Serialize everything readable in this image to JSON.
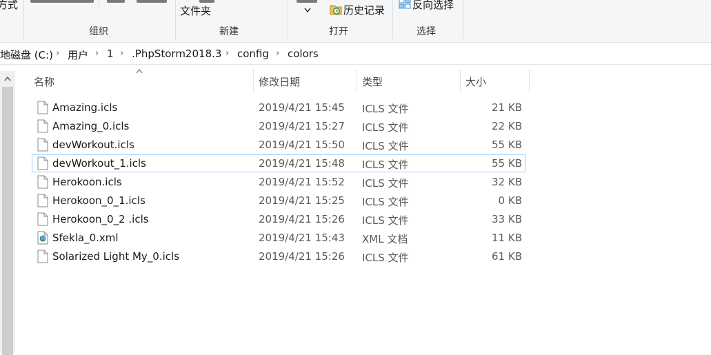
{
  "ribbon": {
    "partial_left": "方式",
    "new_folder_label": "文件夹",
    "history_label": "历史记录",
    "invert_select_label": "反向选择",
    "groups": [
      "组织",
      "新建",
      "打开",
      "选择"
    ]
  },
  "breadcrumb": {
    "items": [
      "地磁盘 (C:)",
      "用户",
      "1",
      ".PhpStorm2018.3",
      "config",
      "colors"
    ]
  },
  "columns": [
    "名称",
    "修改日期",
    "类型",
    "大小"
  ],
  "files": [
    {
      "name": "Amazing.icls",
      "date": "2019/4/21 15:45",
      "type": "ICLS 文件",
      "size": "21 KB",
      "icon": "file-icon"
    },
    {
      "name": "Amazing_0.icls",
      "date": "2019/4/21 15:27",
      "type": "ICLS 文件",
      "size": "22 KB",
      "icon": "file-icon"
    },
    {
      "name": "devWorkout.icls",
      "date": "2019/4/21 15:50",
      "type": "ICLS 文件",
      "size": "55 KB",
      "icon": "file-icon"
    },
    {
      "name": "devWorkout_1.icls",
      "date": "2019/4/21 15:48",
      "type": "ICLS 文件",
      "size": "55 KB",
      "icon": "file-icon",
      "selected": true
    },
    {
      "name": "Herokoon.icls",
      "date": "2019/4/21 15:52",
      "type": "ICLS 文件",
      "size": "32 KB",
      "icon": "file-icon"
    },
    {
      "name": "Herokoon_0_1.icls",
      "date": "2019/4/21 15:25",
      "type": "ICLS 文件",
      "size": "0 KB",
      "icon": "file-icon"
    },
    {
      "name": "Herokoon_0_2 .icls",
      "date": "2019/4/21 15:26",
      "type": "ICLS 文件",
      "size": "33 KB",
      "icon": "file-icon"
    },
    {
      "name": "Sfekla_0.xml",
      "date": "2019/4/21 15:43",
      "type": "XML 文档",
      "size": "11 KB",
      "icon": "xml-file-icon"
    },
    {
      "name": "Solarized Light My_0.icls",
      "date": "2019/4/21 15:26",
      "type": "ICLS 文件",
      "size": "61 KB",
      "icon": "file-icon"
    }
  ],
  "colors": {
    "selection_border": "#99d1ff",
    "ribbon_bg": "#f5f6f7"
  }
}
